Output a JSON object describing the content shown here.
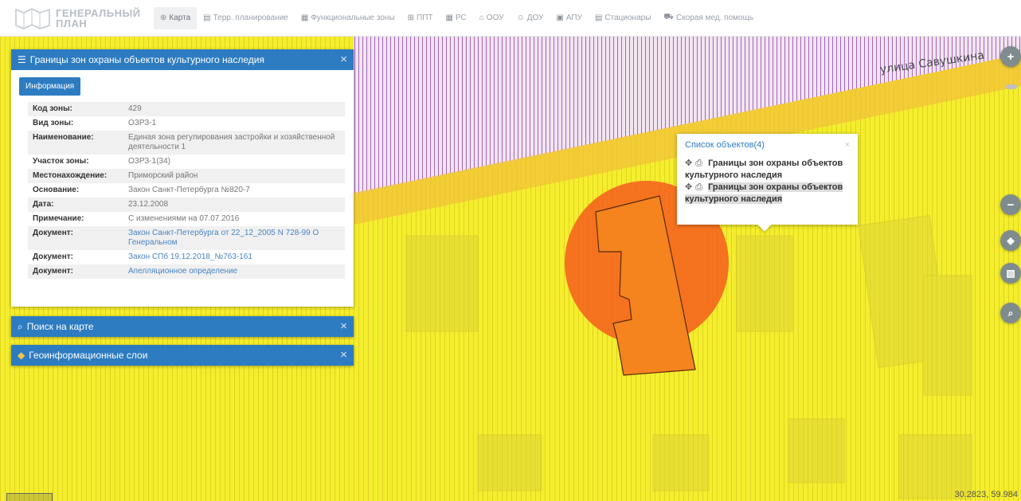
{
  "app": {
    "logo_line1": "ГЕНЕРАЛЬНЫЙ",
    "logo_line2": "ПЛАН"
  },
  "nav": [
    {
      "label": "Карта",
      "icon": "globe-icon",
      "glyph": "⊕",
      "active": true
    },
    {
      "label": "Терр. планирование",
      "icon": "document-icon",
      "glyph": "▤",
      "active": false
    },
    {
      "label": "Функциональные зоны",
      "icon": "grid-doc-icon",
      "glyph": "▦",
      "active": false
    },
    {
      "label": "ППТ",
      "icon": "table-icon",
      "glyph": "⊞",
      "active": false
    },
    {
      "label": "РС",
      "icon": "grid-doc-icon",
      "glyph": "▦",
      "active": false
    },
    {
      "label": "ООУ",
      "icon": "building-icon",
      "glyph": "⌂",
      "active": false
    },
    {
      "label": "ДОУ",
      "icon": "child-icon",
      "glyph": "☺",
      "active": false
    },
    {
      "label": "АПУ",
      "icon": "apu-icon",
      "glyph": "▣",
      "active": false
    },
    {
      "label": "Стационары",
      "icon": "hospital-icon",
      "glyph": "▤",
      "active": false
    },
    {
      "label": "Скорая мед. помощь",
      "icon": "ambulance-icon",
      "glyph": "⛟",
      "active": false
    }
  ],
  "map": {
    "street": "улица Савушкина",
    "coords": "30.2823, 59.984"
  },
  "info_panel": {
    "title": "Границы зон охраны объектов культурного наследия",
    "tab": "Информация",
    "rows": [
      {
        "key": "Код зоны:",
        "value": "429",
        "link": false
      },
      {
        "key": "Вид зоны:",
        "value": "ОЗРЗ-1",
        "link": false
      },
      {
        "key": "Наименование:",
        "value": "Единая зона регулирования застройки и хозяйственной деятельности 1",
        "link": false
      },
      {
        "key": "Участок зоны:",
        "value": "ОЗРЗ-1(34)",
        "link": false
      },
      {
        "key": "Местонахождение:",
        "value": "Приморский район",
        "link": false
      },
      {
        "key": "Основание:",
        "value": "Закон Санкт-Петербурга №820-7",
        "link": false
      },
      {
        "key": "Дата:",
        "value": "23.12.2008",
        "link": false
      },
      {
        "key": "Примечание:",
        "value": "С изменениями на 07.07.2016",
        "link": false
      },
      {
        "key": "Документ:",
        "value": "Закон Санкт-Петербурга от 22_12_2005 N 728-99 О Генеральном",
        "link": true
      },
      {
        "key": "Документ:",
        "value": "Закон СПб 19.12.2018_№763-161",
        "link": true
      },
      {
        "key": "Документ:",
        "value": "Апелляционное определение",
        "link": true
      }
    ]
  },
  "search_panel": {
    "title": "Поиск на карте"
  },
  "layers_panel": {
    "title": "Геоинформационные слои"
  },
  "popup": {
    "title": "Список объектов(4)",
    "items": [
      "Границы зон охраны объектов культурного наследия",
      "Границы зон охраны объектов культурного наследия"
    ]
  },
  "colors": {
    "accent": "#2d7cc1",
    "map_yellow": "#f4ee2e",
    "zone_orange": "#f5651e"
  }
}
